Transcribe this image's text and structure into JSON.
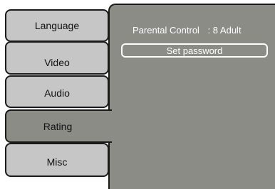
{
  "menu": {
    "tabs": [
      {
        "label": "Language"
      },
      {
        "label": "Video"
      },
      {
        "label": "Audio"
      },
      {
        "label": "Rating"
      },
      {
        "label": "Misc"
      }
    ],
    "active_tab": "Rating"
  },
  "panel": {
    "parental_control_label": "Parental Control",
    "parental_control_value": ": 8 Adult",
    "set_password_label": "Set password"
  },
  "colors": {
    "tab_bg": "#c6c6c6",
    "active_bg": "#8c8c87",
    "border": "#1a1a1a",
    "text_panel": "#ffffff"
  }
}
